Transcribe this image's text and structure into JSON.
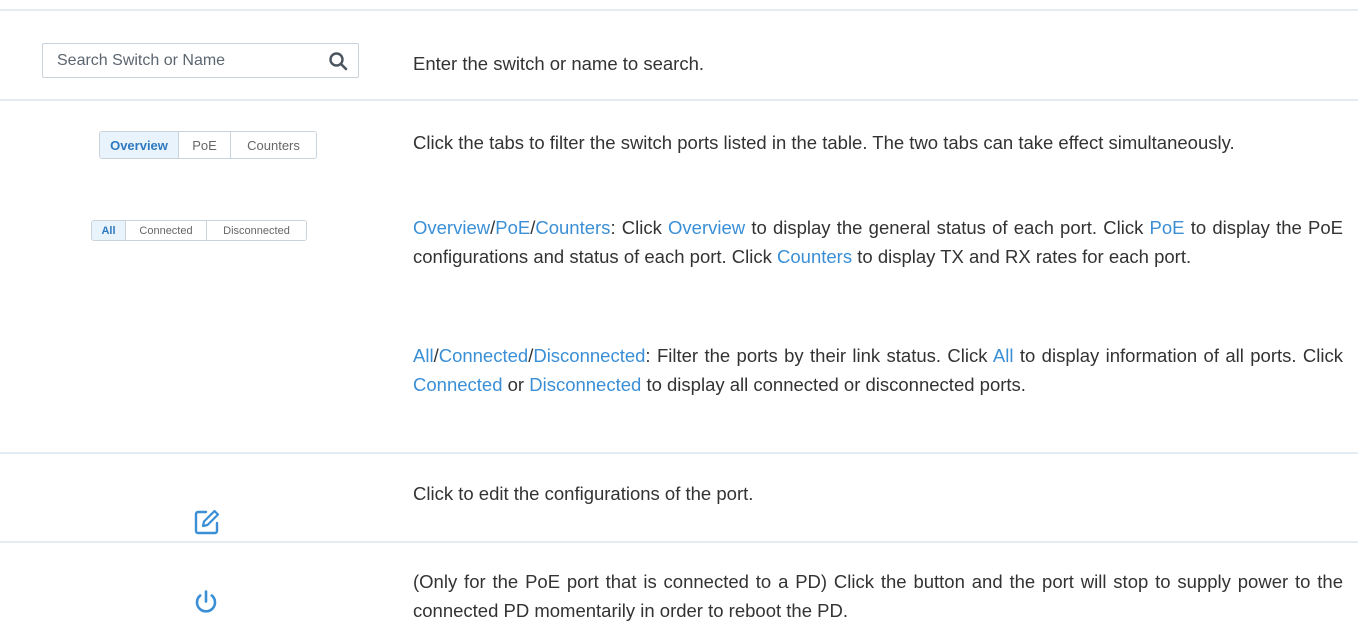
{
  "search": {
    "placeholder": "Search Switch or Name",
    "icon": "search-icon"
  },
  "view_tabs": [
    {
      "label": "Overview",
      "active": true
    },
    {
      "label": "PoE",
      "active": false
    },
    {
      "label": "Counters",
      "active": false
    }
  ],
  "status_tabs": [
    {
      "label": "All",
      "active": true
    },
    {
      "label": "Connected",
      "active": false
    },
    {
      "label": "Disconnected",
      "active": false
    }
  ],
  "rows": {
    "search_desc": "Enter the switch or name to search.",
    "tabs_desc": "Click the tabs to filter the switch ports listed in the table. The two tabs can take effect simultaneously.",
    "view_desc": {
      "opt1": "Overview",
      "sep1": "/",
      "opt2": "PoE",
      "sep2": "/",
      "opt3": "Counters",
      "t1": ": Click ",
      "k1": "Overview",
      "t2": " to display the general status of each port. Click ",
      "k2": "PoE",
      "t3": " to display the PoE configurations and status of each port. Click ",
      "k3": "Counters",
      "t4": " to display TX and RX rates for each port."
    },
    "status_desc": {
      "opt1": "All",
      "sep1": "/",
      "opt2": "Connected",
      "sep2": "/",
      "opt3": "Disconnected",
      "t1": ": Filter the ports by their link status. Click ",
      "k1": "All",
      "t2": " to display information of all ports. Click ",
      "k2": "Connected",
      "t3": " or ",
      "k3": "Disconnected",
      "t4": " to display all connected or disconnected ports."
    },
    "edit_desc": "Click to edit the configurations of the port.",
    "power_desc": "(Only for the PoE port that is connected to a PD) Click the button and the port will stop to supply power to the connected PD momentarily in order to reboot the PD."
  },
  "colors": {
    "accent": "#3a8fd6",
    "text": "#333333",
    "rule": "#e3ecf3",
    "active_tab_bg": "#e9f3fb"
  }
}
